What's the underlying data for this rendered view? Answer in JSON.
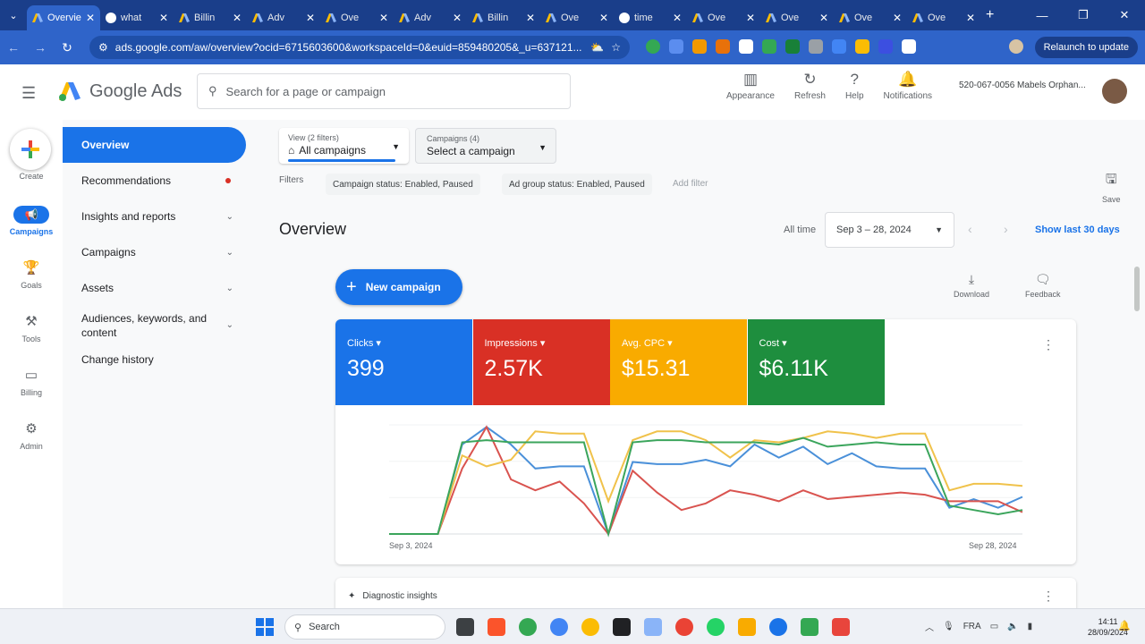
{
  "browser": {
    "tabs": [
      {
        "title": "Overvie",
        "active": true,
        "icon": "google-ads-icon"
      },
      {
        "title": "what",
        "icon": "chrome-globe-icon"
      },
      {
        "title": "Billin",
        "icon": "google-ads-icon"
      },
      {
        "title": "Adv",
        "icon": "google-ads-icon"
      },
      {
        "title": "Ove",
        "icon": "google-ads-icon"
      },
      {
        "title": "Adv",
        "icon": "google-ads-icon"
      },
      {
        "title": "Billin",
        "icon": "google-ads-icon"
      },
      {
        "title": "Ove",
        "icon": "google-ads-icon"
      },
      {
        "title": "time",
        "icon": "chrome-globe-icon"
      },
      {
        "title": "Ove",
        "icon": "google-ads-icon"
      },
      {
        "title": "Ove",
        "icon": "google-ads-icon"
      },
      {
        "title": "Ove",
        "icon": "google-ads-icon"
      },
      {
        "title": "Ove",
        "icon": "google-ads-icon"
      }
    ],
    "url": "ads.google.com/aw/overview?ocid=6715603600&workspaceId=0&euid=859480205&_u=637121...",
    "relaunch_label": "Relaunch to update"
  },
  "app": {
    "name": "Google Ads",
    "search_placeholder": "Search for a page or campaign",
    "actions": [
      {
        "label": "Appearance",
        "icon": "appearance-icon"
      },
      {
        "label": "Refresh",
        "icon": "refresh-icon"
      },
      {
        "label": "Help",
        "icon": "help-icon"
      },
      {
        "label": "Notifications",
        "icon": "bell-icon"
      }
    ],
    "account": "520-067-0056 Mabels Orphan..."
  },
  "rail": [
    {
      "label": "Create",
      "icon": "plus-icon"
    },
    {
      "label": "Campaigns",
      "icon": "megaphone-icon",
      "active": true
    },
    {
      "label": "Goals",
      "icon": "trophy-icon"
    },
    {
      "label": "Tools",
      "icon": "tools-icon"
    },
    {
      "label": "Billing",
      "icon": "credit-card-icon"
    },
    {
      "label": "Admin",
      "icon": "gear-icon"
    }
  ],
  "sidenav": [
    {
      "label": "Overview",
      "active": true
    },
    {
      "label": "Recommendations",
      "dot": true
    },
    {
      "label": "Insights and reports",
      "chevron": true
    },
    {
      "label": "Campaigns",
      "chevron": true
    },
    {
      "label": "Assets",
      "chevron": true
    },
    {
      "label": "Audiences, keywords, and content",
      "chevron": true
    },
    {
      "label": "Change history"
    }
  ],
  "selectors": {
    "view_small": "View (2 filters)",
    "view_value": "All campaigns",
    "campaigns_small": "Campaigns (4)",
    "campaigns_value": "Select a campaign"
  },
  "filters": {
    "label": "Filters",
    "chips": [
      "Campaign status: Enabled, Paused",
      "Ad group status: Enabled, Paused"
    ],
    "add": "Add filter",
    "save": "Save"
  },
  "overview": {
    "title": "Overview",
    "range_label": "All time",
    "date_range": "Sep 3 – 28, 2024",
    "show_last": "Show last 30 days",
    "new_campaign": "New campaign",
    "download": "Download",
    "feedback": "Feedback",
    "diagnostic": "Diagnostic insights"
  },
  "metrics": [
    {
      "label": "Clicks",
      "value": "399",
      "color": "#1a73e8"
    },
    {
      "label": "Impressions",
      "value": "2.57K",
      "color": "#d93025"
    },
    {
      "label": "Avg. CPC",
      "value": "$15.31",
      "color": "#f9ab00"
    },
    {
      "label": "Cost",
      "value": "$6.11K",
      "color": "#1e8e3e"
    }
  ],
  "chart_data": {
    "type": "line",
    "x_start": "Sep 3, 2024",
    "x_end": "Sep 28, 2024",
    "x": [
      "Sep 3",
      "Sep 4",
      "Sep 5",
      "Sep 6",
      "Sep 7",
      "Sep 8",
      "Sep 9",
      "Sep 10",
      "Sep 11",
      "Sep 12",
      "Sep 13",
      "Sep 14",
      "Sep 15",
      "Sep 16",
      "Sep 17",
      "Sep 18",
      "Sep 19",
      "Sep 20",
      "Sep 21",
      "Sep 22",
      "Sep 23",
      "Sep 24",
      "Sep 25",
      "Sep 26",
      "Sep 27",
      "Sep 28"
    ],
    "ylim": [
      0,
      1
    ],
    "grid": true,
    "series": [
      {
        "color": "#4a90d9",
        "values": [
          0.0,
          0.0,
          0.0,
          0.82,
          0.98,
          0.82,
          0.6,
          0.62,
          0.62,
          0.0,
          0.66,
          0.64,
          0.64,
          0.68,
          0.62,
          0.82,
          0.7,
          0.8,
          0.64,
          0.74,
          0.62,
          0.6,
          0.6,
          0.24,
          0.32,
          0.24,
          0.34
        ]
      },
      {
        "color": "#d9534f",
        "values": [
          0.0,
          0.0,
          0.0,
          0.6,
          0.98,
          0.5,
          0.4,
          0.48,
          0.28,
          0.0,
          0.58,
          0.38,
          0.22,
          0.28,
          0.4,
          0.36,
          0.3,
          0.4,
          0.32,
          0.34,
          0.36,
          0.38,
          0.36,
          0.3,
          0.3,
          0.3,
          0.2
        ]
      },
      {
        "color": "#f0c24b",
        "values": [
          0.0,
          0.0,
          0.0,
          0.72,
          0.62,
          0.68,
          0.94,
          0.92,
          0.92,
          0.3,
          0.86,
          0.94,
          0.94,
          0.86,
          0.7,
          0.86,
          0.84,
          0.88,
          0.94,
          0.92,
          0.88,
          0.92,
          0.92,
          0.4,
          0.46,
          0.46,
          0.44
        ]
      },
      {
        "color": "#3ba55c",
        "values": [
          0.0,
          0.0,
          0.0,
          0.84,
          0.86,
          0.84,
          0.84,
          0.84,
          0.84,
          0.0,
          0.84,
          0.86,
          0.86,
          0.84,
          0.84,
          0.84,
          0.82,
          0.88,
          0.8,
          0.82,
          0.84,
          0.82,
          0.82,
          0.26,
          0.22,
          0.18,
          0.22
        ]
      }
    ]
  },
  "taskbar": {
    "search_placeholder": "Search",
    "lang": "FRA",
    "time": "14:11",
    "date": "28/09/2024"
  }
}
